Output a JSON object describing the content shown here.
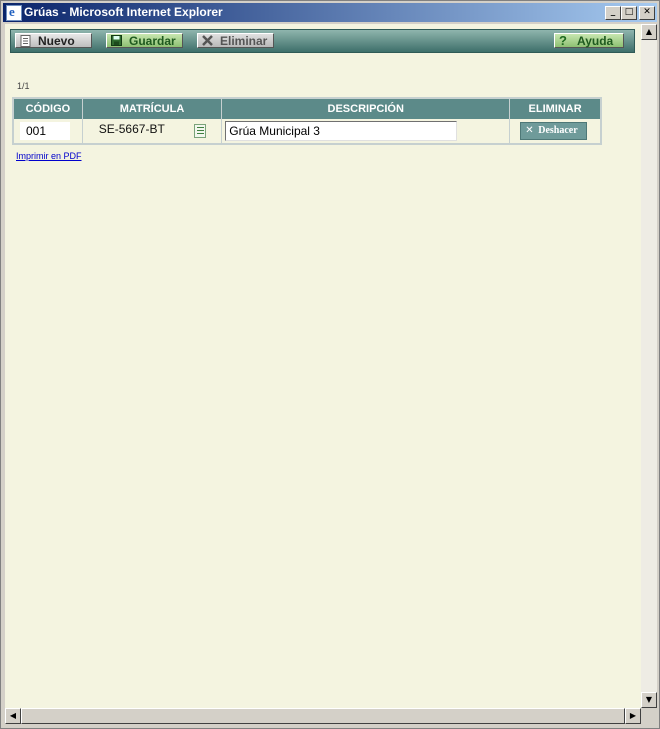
{
  "window": {
    "title": "Grúas - Microsoft Internet Explorer"
  },
  "titlebar_buttons": {
    "minimize": "_",
    "maximize": "□",
    "close": "✕"
  },
  "toolbar": {
    "nuevo_label": "Nuevo",
    "guardar_label": "Guardar",
    "eliminar_label": "Eliminar",
    "ayuda_label": "Ayuda"
  },
  "pager": {
    "text": "1/1"
  },
  "table": {
    "headers": {
      "codigo": "CÓDIGO",
      "matricula": "MATRÍCULA",
      "descripcion": "DESCRIPCIÓN",
      "eliminar": "ELIMINAR"
    },
    "rows": [
      {
        "codigo": "001",
        "matricula": "SE-5667-BT",
        "descripcion": "Grúa Municipal 3",
        "action_label": "Deshacer"
      }
    ]
  },
  "links": {
    "print_pdf": "Imprimir en PDF"
  },
  "icons": [
    "browser-icon",
    "page-icon",
    "save-icon",
    "delete-icon",
    "help-icon",
    "list-icon",
    "undo-icon"
  ],
  "colors": {
    "toolbar_start": "#8fb5ad",
    "toolbar_end": "#3e6f6a",
    "header_bg": "#5c8a89",
    "page_bg": "#f4f4e0"
  }
}
